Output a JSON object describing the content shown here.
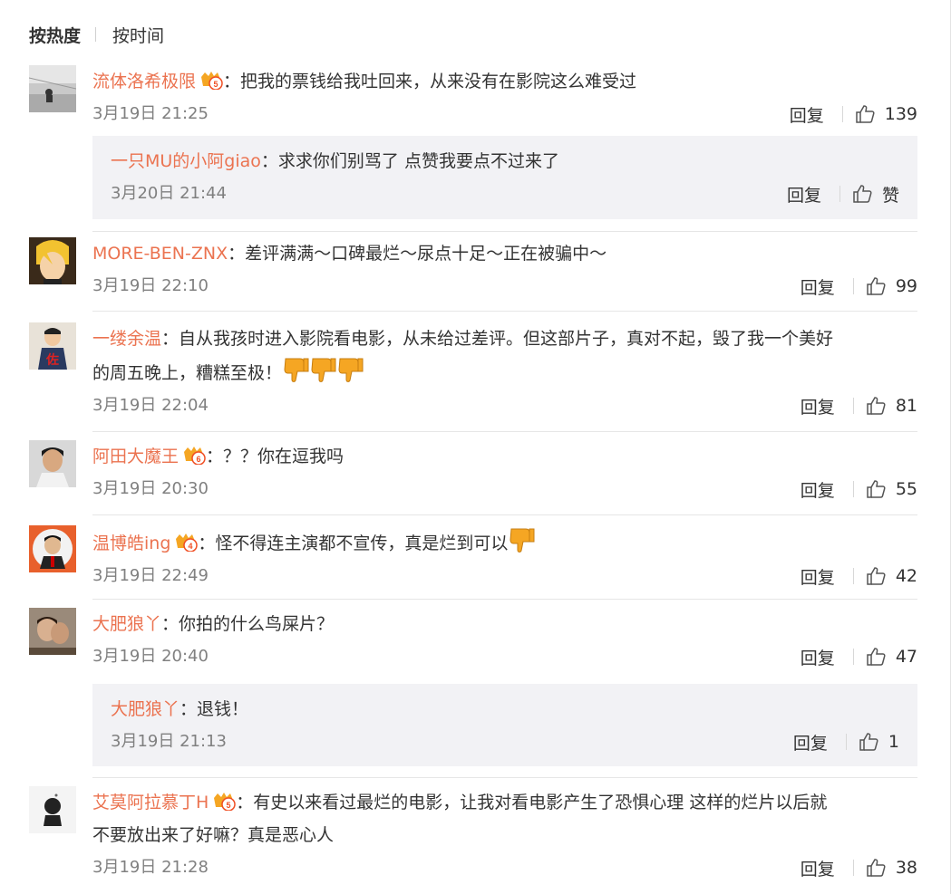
{
  "sort": {
    "hot": "按热度",
    "time": "按时间"
  },
  "reply_label": "回复",
  "colors": {
    "username": "#eb7350",
    "subbox_bg": "#f2f2f5",
    "dislike": "#f5a623"
  },
  "comments": [
    {
      "user": "流体洛希极限",
      "text": "：把我的票钱给我吐回来，从来没有在影院这么难受过",
      "time": "3月19日 21:25",
      "likes": "139",
      "reply": {
        "user": "一只MU的小阿giao",
        "text": "：求求你们别骂了 点赞我要点不过来了",
        "time": "3月20日 21:44",
        "likes": "赞"
      }
    },
    {
      "user": "MORE-BEN-ZNX",
      "text": "：差评满满～口碑最烂～尿点十足～正在被骗中～",
      "time": "3月19日 22:10",
      "likes": "99"
    },
    {
      "user": "一缕余温",
      "text": "：自从我孩时进入影院看电影，从未给过差评。但这部片子，真对不起，毁了我一个美好",
      "text2": "的周五晚上，糟糕至极！",
      "time": "3月19日 22:04",
      "likes": "81"
    },
    {
      "user": "阿田大魔王",
      "text": "：？？你在逗我吗",
      "time": "3月19日 20:30",
      "likes": "55"
    },
    {
      "user": "温博皓ing",
      "text": "：怪不得连主演都不宣传，真是烂到可以",
      "time": "3月19日 22:49",
      "likes": "42"
    },
    {
      "user": "大肥狼丫",
      "text": "：你拍的什么鸟屎片？",
      "time": "3月19日 20:40",
      "likes": "47",
      "reply": {
        "user": "大肥狼丫",
        "text": "：退钱！",
        "time": "3月19日 21:13",
        "likes": "1"
      }
    },
    {
      "user": "艾莫阿拉慕丁H",
      "text": "：有史以来看过最烂的电影，让我对看电影产生了恐惧心理   这样的烂片以后就",
      "text2": "不要放出来了好嘛？真是恶心人",
      "time": "3月19日 21:28",
      "likes": "38"
    }
  ]
}
